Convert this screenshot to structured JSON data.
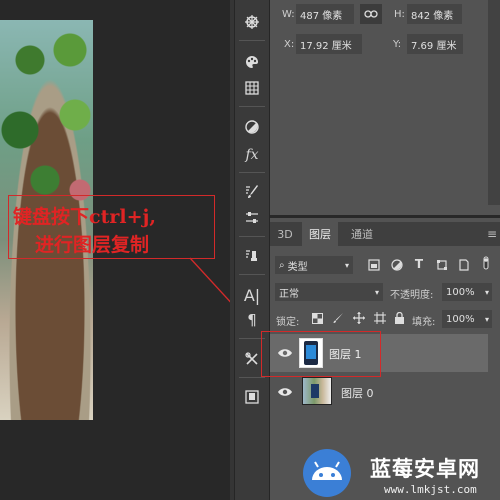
{
  "properties": {
    "w_label": "W:",
    "w_value": "487 像素",
    "h_label": "H:",
    "h_value": "842 像素",
    "x_label": "X:",
    "x_value": "17.92 厘米",
    "y_label": "Y:",
    "y_value": "7.69 厘米",
    "link_icon": "link-icon"
  },
  "annotation": {
    "line1": "键盘按下ctrl+j,",
    "line2": "进行图层复制",
    "color": "#e02424"
  },
  "toolbar": {
    "icons": [
      "settings-wheel-icon",
      "palette-icon",
      "grid-icon",
      "adjustment-circle-icon",
      "fx-icon",
      "brush-settings-icon",
      "sliders-icon",
      "clone-source-icon",
      "character-icon",
      "paragraph-icon",
      "tools-icon",
      "export-icon"
    ]
  },
  "layers_panel": {
    "tabs": [
      "3D",
      "图层",
      "通道"
    ],
    "active_tab": "图层",
    "filter_label": "类型",
    "blend_mode": "正常",
    "opacity_label": "不透明度:",
    "opacity_value": "100%",
    "lock_label": "锁定:",
    "fill_label": "填充:",
    "fill_value": "100%",
    "layers": [
      {
        "name": "图层 1",
        "selected": true
      },
      {
        "name": "图层 0",
        "selected": false
      }
    ]
  },
  "watermark": {
    "title": "蓝莓安卓网",
    "url": "www.lmkjst.com"
  },
  "colors": {
    "panel_bg": "#535353",
    "toolbar_bg": "#3a3a3a",
    "canvas_bg": "#282828",
    "highlight_red": "#d22a2a",
    "selected_layer": "#6a6a6a"
  }
}
